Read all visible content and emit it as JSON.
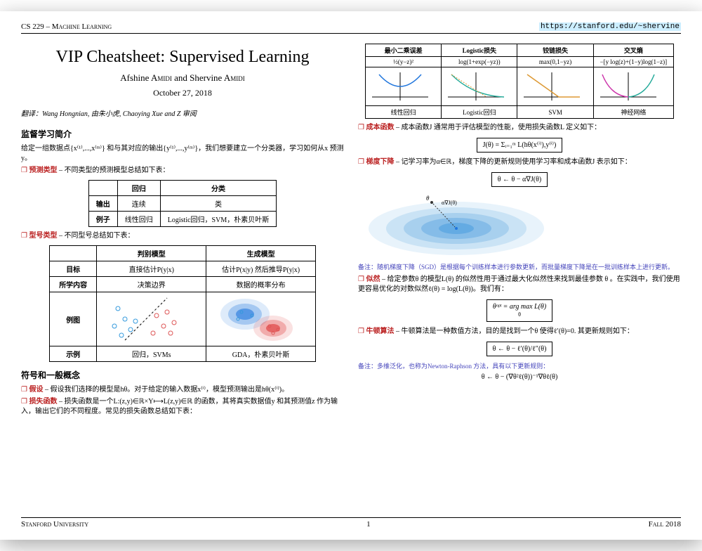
{
  "hdr": {
    "course": "CS 229 – Machine Learning",
    "url": "https://stanford.edu/~shervine"
  },
  "title": "VIP Cheatsheet: Supervised Learning",
  "authors": "Afshine Amidi and Shervine Amidi",
  "date": "October 27, 2018",
  "trans": "翻译：Wang Hongnian, 由朱小虎, Chaoying Xue and Z 审阅",
  "sec1": "监督学习简介",
  "intro": "给定一组数据点{x⁽¹⁾,...,x⁽ᵐ⁾} 和与其对应的输出{y⁽¹⁾,...,y⁽ᵐ⁾}，我们想要建立一个分类器，学习如何从x 预测y。",
  "b1": {
    "t": "预测类型",
    "d": " – 不同类型的预测模型总结如下表："
  },
  "t1": {
    "h": [
      "",
      "回归",
      "分类"
    ],
    "r1": [
      "输出",
      "连续",
      "类"
    ],
    "r2": [
      "例子",
      "线性回归",
      "Logistic回归，SVM，朴素贝叶斯"
    ]
  },
  "b2": {
    "t": "型号类型",
    "d": " – 不同型号总结如下表："
  },
  "t2": {
    "h": [
      "",
      "判别模型",
      "生成模型"
    ],
    "r1": [
      "目标",
      "直接估计P(y|x)",
      "估计P(x|y) 然后推导P(y|x)"
    ],
    "r2": [
      "所学内容",
      "决策边界",
      "数据的概率分布"
    ],
    "r3": "例图",
    "r4": [
      "示例",
      "回归，SVMs",
      "GDA，朴素贝叶斯"
    ]
  },
  "sec2": "符号和一般概念",
  "b3": {
    "t": "假设",
    "d": " – 假设我们选择的模型是hθ。对于给定的输入数据x⁽ⁱ⁾，模型预测输出是hθ(x⁽ⁱ⁾)。"
  },
  "b4": {
    "t": "损失函数",
    "d": " – 损失函数是一个L:(z,y)∈ℝ×Y⟼L(z,y)∈ℝ 的函数，其将真实数据值y 和其预测值z 作为输入，输出它们的不同程度。常见的损失函数总结如下表："
  },
  "loss": {
    "h": [
      "最小二乘误差",
      "Logistic损失",
      "铰链损失",
      "交叉熵"
    ],
    "f": [
      "½(y−z)²",
      "log(1+exp(−yz))",
      "max(0,1−yz)",
      "−[y log(z)+(1−y)log(1−z)]"
    ],
    "n": [
      "线性回归",
      "Logistic回归",
      "SVM",
      "神经网络"
    ]
  },
  "b5": {
    "t": "成本函数",
    "d": " – 成本函数J 通常用于评估模型的性能，使用损失函数L 定义如下："
  },
  "eq1": "J(θ) = Σᵢ₌₁ᵐ L(hθ(x⁽ⁱ⁾),y⁽ⁱ⁾)",
  "b6": {
    "t": "梯度下降",
    "d": " – 记学习率为α∈ℝ，梯度下降的更新规则使用学习率和成本函数J 表示如下："
  },
  "eq2": "θ ← θ − α∇J(θ)",
  "note1": "备注：随机梯度下降（SGD）是根据每个训练样本进行参数更新，而批量梯度下降是在一批训练样本上进行更新。",
  "b7": {
    "t": "似然",
    "d": " – 给定参数θ 的模型L(θ) 的似然性用于通过最大化似然性来找到最佳参数 θ 。在实践中，我们使用更容易优化的对数似然ℓ(θ) = log(L(θ))。我们有："
  },
  "eq3": "θᵒᵖᵗ = arg max L(θ)",
  "b8": {
    "t": "牛顿算法",
    "d": " – 牛顿算法是一种数值方法，目的是找到一个θ 使得ℓ′(θ)=0. 其更新规则如下："
  },
  "eq4": "θ ← θ − ℓ′(θ)/ℓ″(θ)",
  "note2": "备注：多维泛化，也称为Newton-Raphson 方法，具有以下更新规则：",
  "eq5": "θ ← θ − (∇θ²ℓ(θ))⁻¹∇θℓ(θ)",
  "ftr": {
    "l": "Stanford University",
    "c": "1",
    "r": "Fall 2018"
  }
}
